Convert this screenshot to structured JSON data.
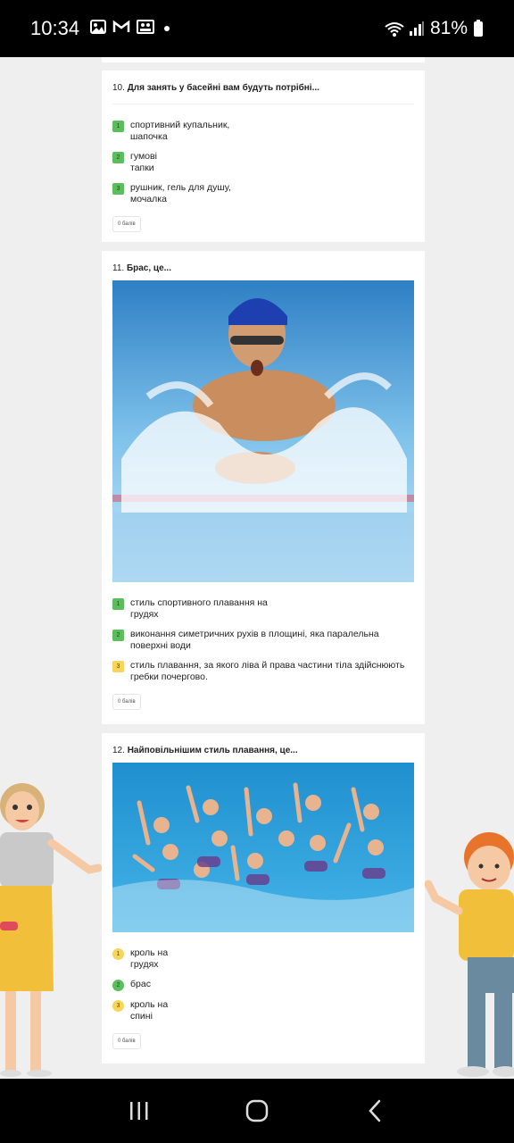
{
  "status_bar": {
    "time": "10:34",
    "notification_icons": [
      "gallery-icon",
      "gmail-icon",
      "photo-icon"
    ],
    "battery": "81%"
  },
  "questions": [
    {
      "number": "10.",
      "title": "Для занять у басейні вам будуть потрібні...",
      "answers": [
        {
          "num": "1",
          "text_lines": [
            "спортивний купальник,",
            "шапочка"
          ]
        },
        {
          "num": "2",
          "text_lines": [
            "гумові",
            "тапки"
          ]
        },
        {
          "num": "3",
          "text_lines": [
            "рушник, гель для душу,",
            "мочалка"
          ]
        }
      ],
      "points": "0 балів"
    },
    {
      "number": "11.",
      "title": "Брас, це...",
      "image": "swimmer-breaststroke-photo",
      "answers": [
        {
          "num": "1",
          "text_lines": [
            "стиль спортивного плавання на",
            "грудях"
          ]
        },
        {
          "num": "2",
          "text_lines": [
            "виконання симетричних рухів в площині, яка паралельна",
            "поверхні води"
          ]
        },
        {
          "num": "3",
          "text_lines": [
            "стиль плавання, за якого ліва й права частини тіла здійснюють",
            "гребки почергово."
          ]
        }
      ],
      "points": "0 балів"
    },
    {
      "number": "12.",
      "title": "Найповільнішим стиль плавання, це...",
      "image": "synchronized-swimming-photo",
      "answers": [
        {
          "num": "1",
          "text_lines": [
            "кроль на",
            "грудях"
          ]
        },
        {
          "num": "2",
          "text_lines": [
            "брас"
          ]
        },
        {
          "num": "3",
          "text_lines": [
            "кроль на",
            "спині"
          ]
        }
      ],
      "points": "0 балів"
    }
  ],
  "colors": {
    "answer_green": "#5cbd5c",
    "answer_yellow": "#f6d55a",
    "page_bg": "#efefef"
  },
  "nav_bar": [
    "recents-icon",
    "home-icon",
    "back-icon"
  ]
}
